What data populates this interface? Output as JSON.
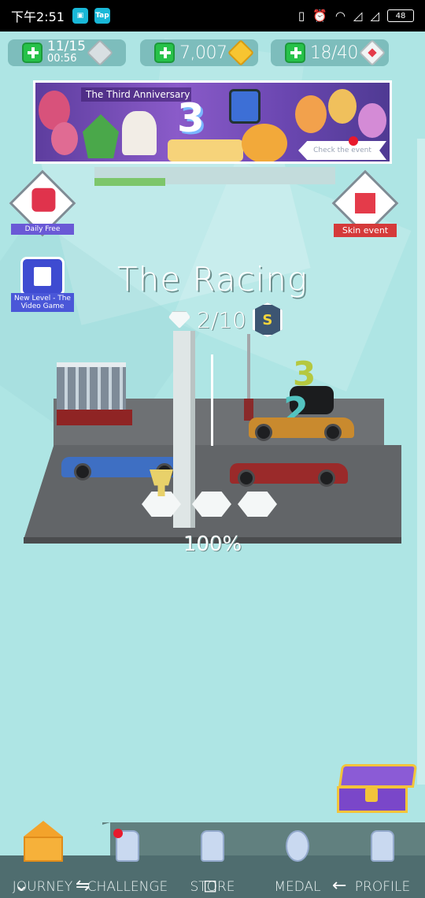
{
  "status_bar": {
    "time": "下午2:51",
    "app_badge": "Tap",
    "battery": "48"
  },
  "resources": {
    "lives": {
      "count": "11/15",
      "timer": "00:56"
    },
    "coins": {
      "count": "7,007"
    },
    "gems": {
      "count": "18/40"
    }
  },
  "banner": {
    "title": "The Third Anniversary",
    "numeral": "3",
    "cta": "Check the event"
  },
  "side_buttons": {
    "daily_free": "Daily Free",
    "skin_event": "Skin event",
    "new_level": "New Level - The Video Game"
  },
  "level": {
    "title": "The Racing",
    "gems_progress": "2/10",
    "rank": "S",
    "completion": "100%"
  },
  "scene": {
    "podium_numbers": [
      "3",
      "2"
    ]
  },
  "bottom_nav": {
    "items": [
      {
        "label": "JOURNEY"
      },
      {
        "label": "CHALLENGE"
      },
      {
        "label": "STORE"
      },
      {
        "label": "MEDAL"
      },
      {
        "label": "PROFILE"
      }
    ]
  },
  "system_nav": {
    "down": "⌄",
    "recents": "⇋",
    "home": "◻",
    "back": "←"
  },
  "colors": {
    "background": "#aee5e4",
    "plus_green": "#27c24a",
    "coin_gold": "#f7c531",
    "nav_dark": "#4f6d6f"
  }
}
